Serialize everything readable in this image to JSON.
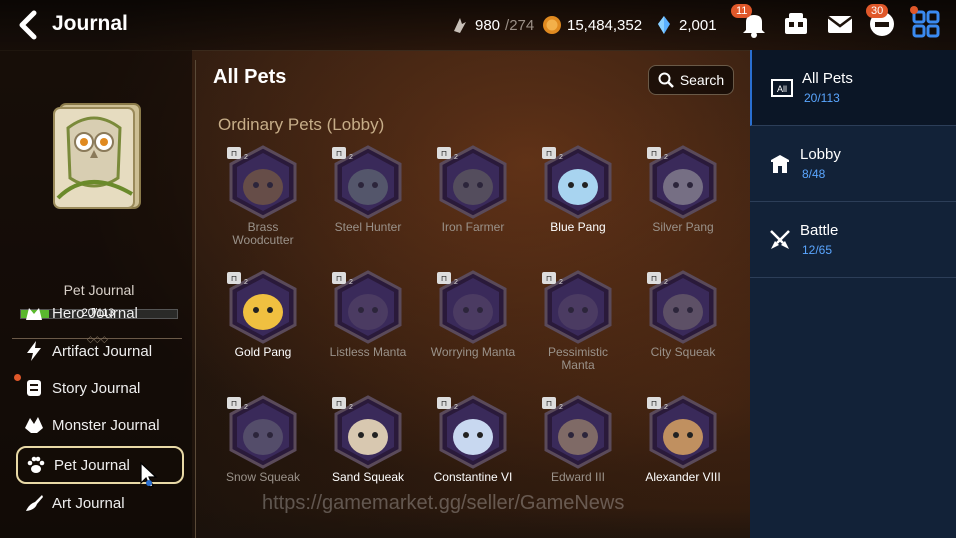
{
  "header": {
    "title": "Journal",
    "stamina": "980",
    "stamina_max": "/274",
    "gold": "15,484,352",
    "crystals": "2,001",
    "notification_count": "11",
    "mail_badge": "30"
  },
  "left": {
    "journal_label": "Pet Journal",
    "progress_text": "20/113",
    "progress_fraction": 0.177,
    "nav": [
      {
        "label": "Hero Journal"
      },
      {
        "label": "Artifact Journal"
      },
      {
        "label": "Story Journal"
      },
      {
        "label": "Monster Journal"
      },
      {
        "label": "Pet Journal"
      },
      {
        "label": "Art Journal"
      }
    ]
  },
  "main": {
    "title": "All Pets",
    "search_label": "Search",
    "subtitle": "Ordinary Pets (Lobby)",
    "pets": [
      {
        "name": "Brass Woodcutter",
        "lines": [
          "Brass",
          "Woodcutter"
        ],
        "owned": false,
        "color": "#8a6a3a"
      },
      {
        "name": "Steel Hunter",
        "lines": [
          "Steel Hunter"
        ],
        "owned": false,
        "color": "#6a7a7a"
      },
      {
        "name": "Iron Farmer",
        "lines": [
          "Iron Farmer"
        ],
        "owned": false,
        "color": "#6a6a60"
      },
      {
        "name": "Blue Pang",
        "lines": [
          "Blue Pang"
        ],
        "owned": true,
        "color": "#a8d4f0"
      },
      {
        "name": "Silver Pang",
        "lines": [
          "Silver Pang"
        ],
        "owned": false,
        "color": "#a8a8a8"
      },
      {
        "name": "Gold Pang",
        "lines": [
          "Gold Pang"
        ],
        "owned": true,
        "color": "#f0c040"
      },
      {
        "name": "Listless Manta",
        "lines": [
          "Listless Manta"
        ],
        "owned": false,
        "color": "#5a4a6a"
      },
      {
        "name": "Worrying Manta",
        "lines": [
          "Worrying Manta"
        ],
        "owned": false,
        "color": "#5a4a6a"
      },
      {
        "name": "Pessimistic Manta",
        "lines": [
          "Pessimistic",
          "Manta"
        ],
        "owned": false,
        "color": "#5a4a6a"
      },
      {
        "name": "City Squeak",
        "lines": [
          "City Squeak"
        ],
        "owned": false,
        "color": "#7a7070"
      },
      {
        "name": "Snow Squeak",
        "lines": [
          "Snow Squeak"
        ],
        "owned": false,
        "color": "#6a6a78"
      },
      {
        "name": "Sand Squeak",
        "lines": [
          "Sand Squeak"
        ],
        "owned": true,
        "color": "#d8c8b0"
      },
      {
        "name": "Constantine VI",
        "lines": [
          "Constantine VI"
        ],
        "owned": true,
        "color": "#c8d8f0"
      },
      {
        "name": "Edward III",
        "lines": [
          "Edward III"
        ],
        "owned": false,
        "color": "#b8a070"
      },
      {
        "name": "Alexander VIII",
        "lines": [
          "Alexander VIII"
        ],
        "owned": true,
        "color": "#c09060"
      }
    ]
  },
  "categories": [
    {
      "label": "All Pets",
      "count": "20/113",
      "icon": "all-icon"
    },
    {
      "label": "Lobby",
      "count": "8/48",
      "icon": "house-icon"
    },
    {
      "label": "Battle",
      "count": "12/65",
      "icon": "swords-icon"
    }
  ],
  "watermark": "https://gamemarket.gg/seller/GameNews",
  "colors": {
    "accent_blue": "#2a6fd0",
    "count_blue": "#5aa6ff",
    "progress_green": "#5ab82e",
    "badge_orange": "#e0582a"
  }
}
